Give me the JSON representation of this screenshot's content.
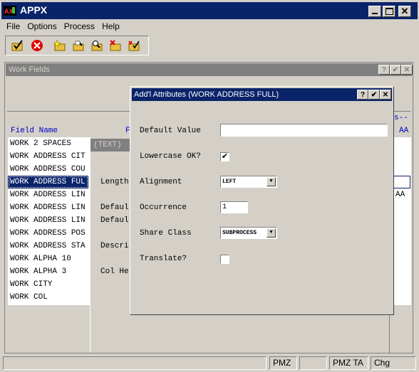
{
  "app": {
    "title": "APPX",
    "icon": "appx-logo-icon"
  },
  "menu": {
    "items": [
      {
        "label": "File",
        "underline": "F"
      },
      {
        "label": "Options",
        "underline": "O"
      },
      {
        "label": "Process",
        "underline": "P"
      },
      {
        "label": "Help",
        "underline": "H"
      }
    ]
  },
  "toolbar": {
    "icons": [
      "check-folder-icon",
      "cancel-red-icon",
      "star-folder-icon",
      "edit-folder-icon",
      "search-folder-icon",
      "delete-folder-icon",
      "check-delete-folder-icon"
    ]
  },
  "work_fields": {
    "title": "Work Fields",
    "header_fragment": "s--",
    "col_field_name": "Field Name",
    "col_f": "F",
    "col_aa": "AA",
    "rows": [
      {
        "name": "WORK 2 SPACES",
        "aa": ""
      },
      {
        "name": "WORK ADDRESS CIT",
        "aa": ""
      },
      {
        "name": "WORK ADDRESS COU",
        "aa": ""
      },
      {
        "name": "WORK ADDRESS FUL",
        "aa": "",
        "selected": true
      },
      {
        "name": "WORK ADDRESS LIN",
        "aa": "AA"
      },
      {
        "name": "WORK ADDRESS LIN",
        "aa": ""
      },
      {
        "name": "WORK ADDRESS LIN",
        "aa": ""
      },
      {
        "name": "WORK ADDRESS POS",
        "aa": ""
      },
      {
        "name": "WORK ADDRESS STA",
        "aa": ""
      },
      {
        "name": "WORK ALPHA 10",
        "aa": ""
      },
      {
        "name": "WORK ALPHA 3",
        "aa": ""
      },
      {
        "name": "WORK CITY",
        "aa": ""
      },
      {
        "name": "WORK COL",
        "aa": ""
      }
    ]
  },
  "detail_panel": {
    "title": "(TEXT)",
    "labels": {
      "length": "Length",
      "default1": "Defaul",
      "default2": "Defaul",
      "description": "Descri",
      "col_heading": "Col He"
    }
  },
  "dialog": {
    "title": "Add'l Attributes (WORK ADDRESS FULL)",
    "default_value_label": "Default Value",
    "default_value": "",
    "lowercase_label": "Lowercase OK?",
    "lowercase_checked": true,
    "alignment_label": "Alignment",
    "alignment_value": "LEFT",
    "occurrence_label": "Occurrence",
    "occurrence_value": "1",
    "share_class_label": "Share Class",
    "share_class_value": "SUBPROCESS",
    "translate_label": "Translate?",
    "translate_checked": false
  },
  "status_bar": {
    "cells": [
      "",
      "PMZ",
      "",
      "PMZ TA",
      "Chg"
    ]
  },
  "colors": {
    "title_active": "#0a246a",
    "title_inactive": "#808080",
    "accent_text": "#0000c0",
    "window_bg": "#d4d0c8"
  }
}
